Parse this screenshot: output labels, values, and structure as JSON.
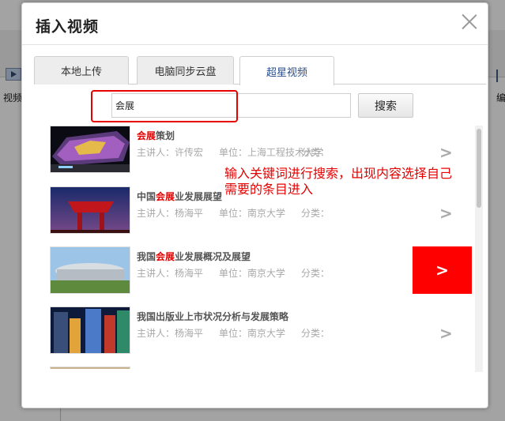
{
  "background": {
    "toolbar": {
      "video_label": "视频",
      "edit_label": "编"
    }
  },
  "dialog": {
    "title": "插入视频",
    "tabs": [
      {
        "label": "本地上传",
        "active": false
      },
      {
        "label": "电脑同步云盘",
        "active": false
      },
      {
        "label": "超星视频",
        "active": true
      }
    ],
    "search": {
      "value": "会展",
      "button_label": "搜索"
    },
    "results": [
      {
        "title_keyword": "会展",
        "title_rest": "策划",
        "title_prefix": "",
        "lecturer": "主讲人：许传宏",
        "unit": "单位：上海工程技术大学",
        "category": "分类：",
        "arrow": ">"
      },
      {
        "title_prefix": "中国",
        "title_keyword": "会展",
        "title_rest": "业发展展望",
        "lecturer": "主讲人：杨海平",
        "unit": "单位：南京大学",
        "category": "分类：",
        "arrow": ">"
      },
      {
        "title_prefix": "我国",
        "title_keyword": "会展",
        "title_rest": "业发展概况及展望",
        "lecturer": "主讲人：杨海平",
        "unit": "单位：南京大学",
        "category": "分类：",
        "arrow": ">"
      },
      {
        "title_prefix": "我国出版业上市状况分析与发展策略",
        "title_keyword": "",
        "title_rest": "",
        "lecturer": "主讲人：杨海平",
        "unit": "单位：南京大学",
        "category": "分类：",
        "arrow": ">"
      }
    ],
    "highlight_arrow": ">",
    "annotation": "输入关键词进行搜索，出现内容选择自己需要的条目进入"
  },
  "colors": {
    "keyword": "#e60000",
    "annotation": "#e60000",
    "highlight": "#ff0000"
  }
}
